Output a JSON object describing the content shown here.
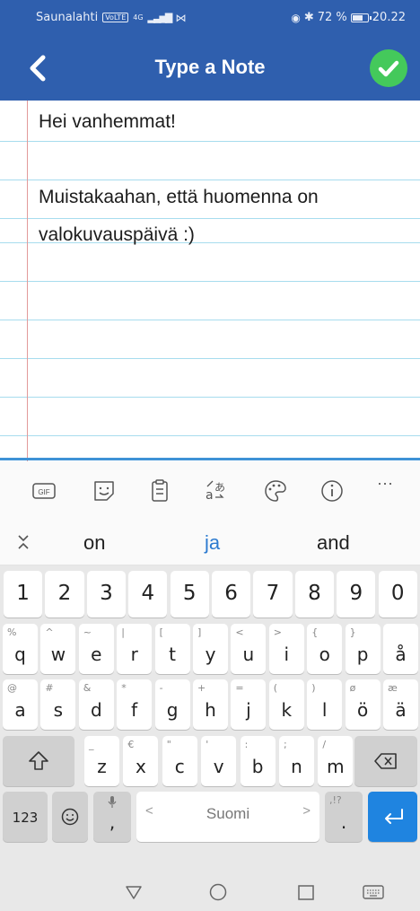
{
  "status_bar": {
    "carrier": "Saunalahti",
    "volte": "VoLTE",
    "network": "4G",
    "battery": "72 %",
    "battery_level": 0.72,
    "time": "20.22"
  },
  "app_bar": {
    "title": "Type a Note"
  },
  "note": {
    "lines": [
      "Hei vanhemmat!",
      "",
      "Muistakaahan, että huomenna on",
      "valokuvauspäivä :)"
    ]
  },
  "keyboard_toolbar": {
    "gif_label": "GIF",
    "more_label": "···"
  },
  "suggestions": [
    "on",
    "ja",
    "and"
  ],
  "keyboard": {
    "number_row": [
      "1",
      "2",
      "3",
      "4",
      "5",
      "6",
      "7",
      "8",
      "9",
      "0"
    ],
    "row1": [
      {
        "key": "q",
        "alt": "%"
      },
      {
        "key": "w",
        "alt": "^"
      },
      {
        "key": "e",
        "alt": "~"
      },
      {
        "key": "r",
        "alt": "|"
      },
      {
        "key": "t",
        "alt": "["
      },
      {
        "key": "y",
        "alt": "]"
      },
      {
        "key": "u",
        "alt": "<"
      },
      {
        "key": "i",
        "alt": ">"
      },
      {
        "key": "o",
        "alt": "{"
      },
      {
        "key": "p",
        "alt": "}"
      },
      {
        "key": "å",
        "alt": ""
      }
    ],
    "row2": [
      {
        "key": "a",
        "alt": "@"
      },
      {
        "key": "s",
        "alt": "#"
      },
      {
        "key": "d",
        "alt": "&"
      },
      {
        "key": "f",
        "alt": "*"
      },
      {
        "key": "g",
        "alt": "-"
      },
      {
        "key": "h",
        "alt": "+"
      },
      {
        "key": "j",
        "alt": "="
      },
      {
        "key": "k",
        "alt": "("
      },
      {
        "key": "l",
        "alt": ")"
      },
      {
        "key": "ö",
        "alt": "ø"
      },
      {
        "key": "ä",
        "alt": "æ"
      }
    ],
    "row3": [
      {
        "key": "z",
        "alt": "_"
      },
      {
        "key": "x",
        "alt": "€"
      },
      {
        "key": "c",
        "alt": "\""
      },
      {
        "key": "v",
        "alt": "'"
      },
      {
        "key": "b",
        "alt": ":"
      },
      {
        "key": "n",
        "alt": ";"
      },
      {
        "key": "m",
        "alt": "/"
      }
    ],
    "symbols_label": "123",
    "comma": ",",
    "space_label": "Suomi",
    "period": ".",
    "period_alt": ",!?"
  },
  "colors": {
    "app_bar": "#2f5fae",
    "confirm": "#44c95b",
    "accent": "#1f84e0",
    "ruled_line": "#a7dcee",
    "margin_line": "#e29a9a"
  }
}
